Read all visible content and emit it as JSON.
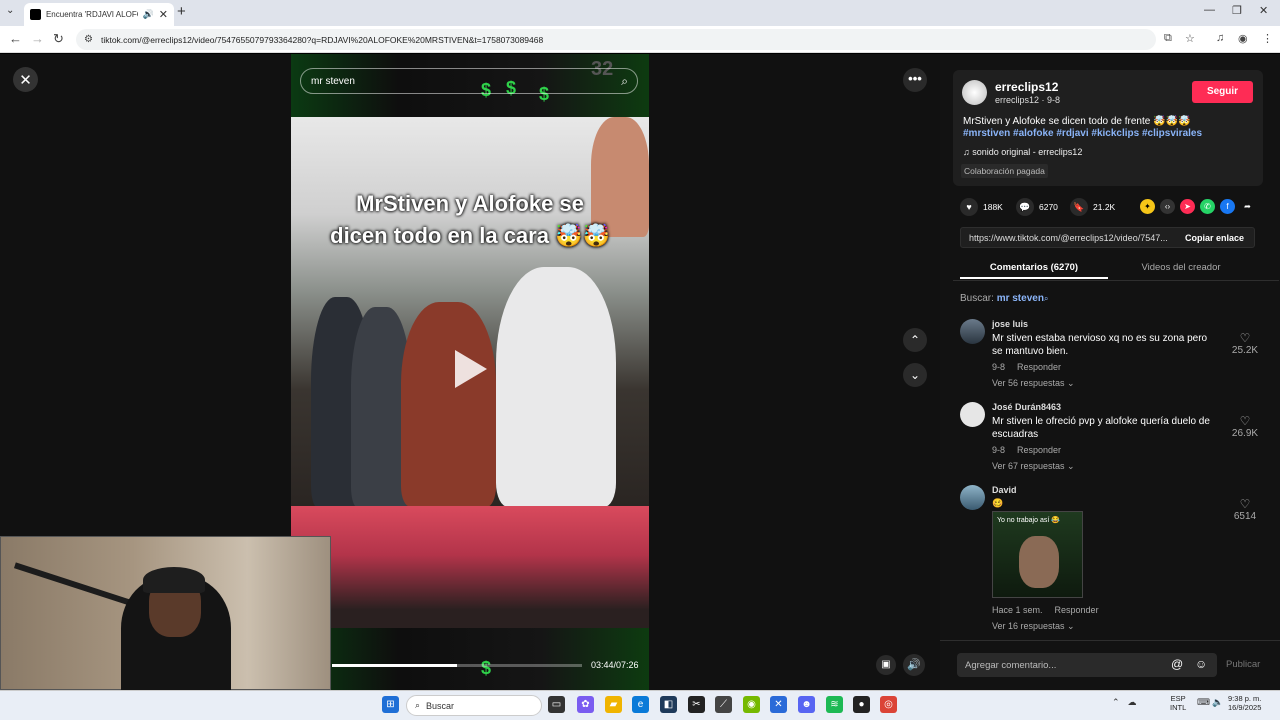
{
  "browser": {
    "tab_title": "Encuentra 'RDJAVI ALOFOK",
    "url": "tiktok.com/@erreclips12/video/7547655079793364280?q=RDJAVI%20ALOFOKE%20MRSTIVEN&t=1758073089468"
  },
  "video": {
    "search_query": "mr steven",
    "caption_line1": "MrStiven y Alofoke se",
    "caption_line2": "dicen todo en la cara 🤯🤯",
    "time": "03:44/07:26",
    "progress": 0.5,
    "overlay_number": "32"
  },
  "creator": {
    "username": "erreclips12",
    "sub": "erreclips12 · 9-8",
    "follow_label": "Seguir",
    "description": "MrStiven y Alofoke se dicen todo de frente 🤯🤯🤯",
    "hashtags": "#mrstiven #alofoke #rdjavi #kickclips #clipsvirales",
    "sound": "sonido original - erreclips12",
    "paid_label": "Colaboración pagada"
  },
  "stats": {
    "likes": "188K",
    "comments": "6270",
    "saves": "21.2K"
  },
  "link": {
    "url": "https://www.tiktok.com/@erreclips12/video/7547...",
    "copy_label": "Copiar enlace"
  },
  "tabs": {
    "comments": "Comentarios (6270)",
    "creator_videos": "Videos del creador"
  },
  "search": {
    "label": "Buscar:",
    "term": "mr steven"
  },
  "comments": [
    {
      "name": "jose luis",
      "text": "Mr stiven estaba nervioso xq no es su zona pero se mantuvo bien.",
      "date": "9-8",
      "reply": "Responder",
      "replies": "Ver 56 respuestas ⌄",
      "likes": "25.2K"
    },
    {
      "name": "José Durán8463",
      "text": "Mr stiven le ofreció pvp y alofoke quería duelo de escuadras",
      "date": "9-8",
      "reply": "Responder",
      "replies": "Ver 67 respuestas ⌄",
      "likes": "26.9K"
    },
    {
      "name": "David",
      "text": "",
      "gif_text": "Yo no trabajo así 😂",
      "date": "Hace 1 sem.",
      "reply": "Responder",
      "replies": "Ver 16 respuestas ⌄",
      "likes": "6514"
    }
  ],
  "add_comment": {
    "placeholder": "Agregar comentario...",
    "publish": "Publicar"
  },
  "taskbar": {
    "search": "Buscar",
    "lang_top": "ESP",
    "lang_bottom": "INTL",
    "time": "9:38 p. m.",
    "date": "16/9/2025"
  },
  "colors": {
    "accent": "#fe2c55",
    "hashtag": "#8ab4f8",
    "panel_bg": "#121212"
  }
}
